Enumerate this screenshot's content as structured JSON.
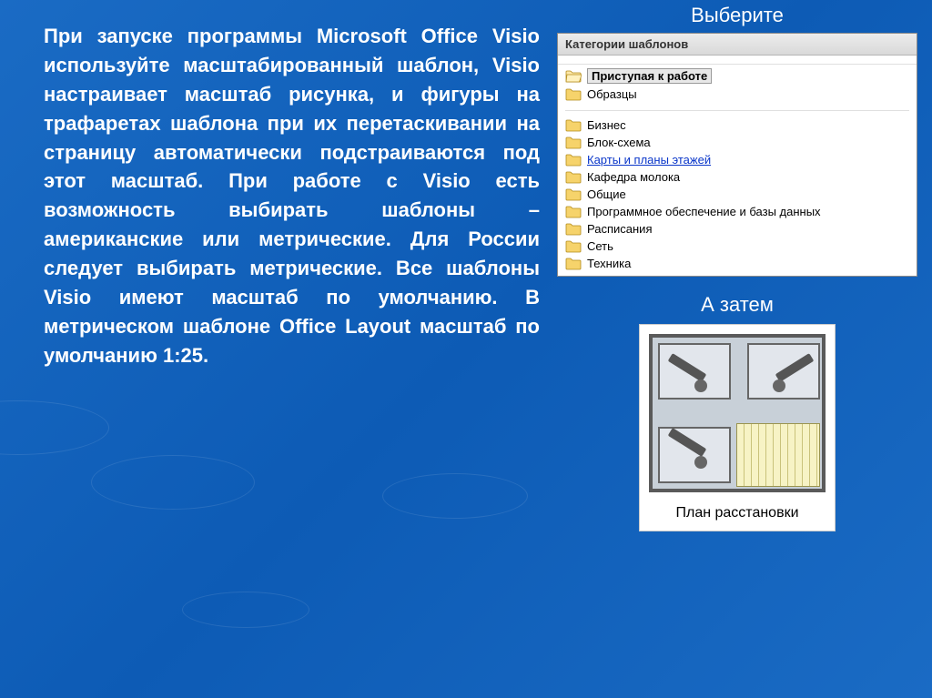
{
  "main_text": "При запуске программы Microsoft Office Visio используйте масштабированный шаблон, Visio настраивает масштаб рисунка, и фигуры на трафаретах шаблона при их перетаскивании на страницу автоматически подстраиваются под этот масштаб. При работе с Visio есть возможность выбирать шаблоны – американские или метрические. Для России следует выбирать метрические. Все шаблоны Visio имеют масштаб по умолчанию. В метрическом шаблоне Office Layout масштаб по умолчанию 1:25.",
  "heading_top": "Выберите",
  "heading_mid": "А затем",
  "panel_title": "Категории шаблонов",
  "categories_top": [
    {
      "label": "Приступая к работе",
      "selected": true,
      "icon": "open"
    },
    {
      "label": "Образцы",
      "selected": false,
      "icon": "closed"
    }
  ],
  "categories_main": [
    {
      "label": "Бизнес",
      "link": false
    },
    {
      "label": "Блок-схема",
      "link": false
    },
    {
      "label": "Карты и планы этажей",
      "link": true
    },
    {
      "label": "Кафедра молока",
      "link": false
    },
    {
      "label": "Общие",
      "link": false
    },
    {
      "label": "Программное обеспечение и базы данных",
      "link": false
    },
    {
      "label": "Расписания",
      "link": false
    },
    {
      "label": "Сеть",
      "link": false
    },
    {
      "label": "Техника",
      "link": false
    }
  ],
  "thumb_caption": "План расстановки"
}
